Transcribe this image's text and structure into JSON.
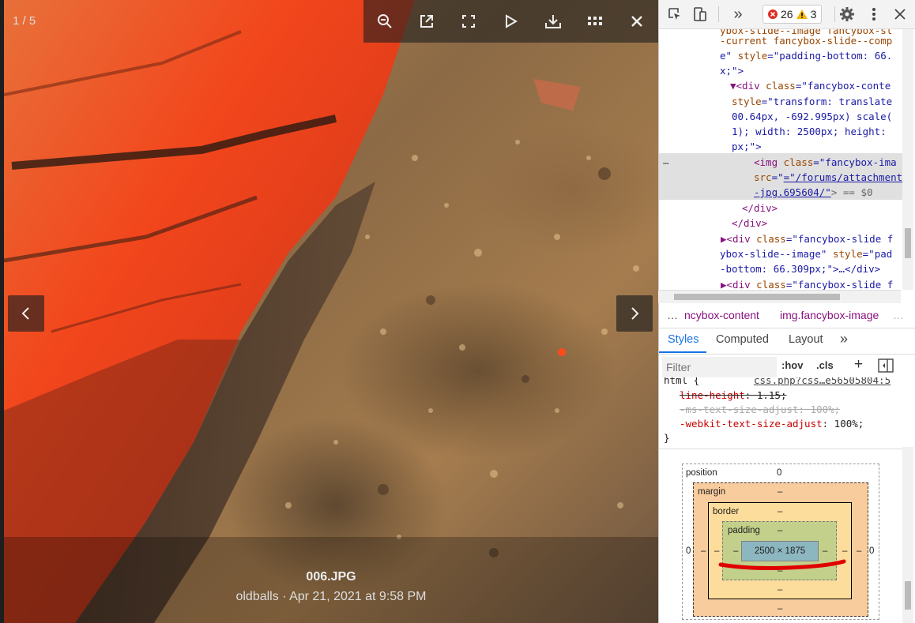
{
  "viewer": {
    "counter": "1 / 5",
    "toolbar_icons": [
      "zoom-out-icon",
      "external-link-icon",
      "fullscreen-icon",
      "play-icon",
      "download-icon",
      "thumbnails-icon",
      "close-icon"
    ],
    "caption_title": "006.JPG",
    "caption_meta": "oldballs · Apr 21, 2021 at 9:58 PM"
  },
  "devtools": {
    "error_count": "26",
    "warning_count": "3",
    "elements_lines": [
      {
        "l1": "e\" ",
        "a": "style",
        "v": "\"padding-bottom: 66."
      },
      {
        "t": "x;\">"
      }
    ],
    "code": {
      "line0": "ybox-slide--image fancybox-sl",
      "line1a": "-current fancybox-slide--comp",
      "line2a": "e\"",
      "line2b": "style",
      "line2c": "=\"padding-bottom: 66.",
      "line3": "x;\">",
      "line4tag": "▼<div",
      "line4attr": "class",
      "line4val": "=\"fancybox-conte",
      "line5attr": "style",
      "line5val": "=\"transform: translate",
      "line6": "00.64px, -692.995px) scale(",
      "line7": "1); width: 2500px; height:",
      "line8": "px;\">",
      "line9tag": "<img",
      "line9attr": "class",
      "line9val": "=\"fancybox-ima",
      "line10attr": "src",
      "line10val": "=\"/forums/attachments",
      "line11val": "-jpg.695604/\"",
      "line11end": "> == $0",
      "line12": "</div>",
      "line13": "</div>",
      "line14tag": "▶<div",
      "line14attr": "class",
      "line14val": "=\"fancybox-slide f",
      "line15a": "ybox-slide--image\"",
      "line15b": "style",
      "line15c": "=\"pad",
      "line16": "-bottom: 66.309px;\">…</div>",
      "line17tag": "▶<div",
      "line17attr": "class",
      "line17val": "=\"fancybox-slide f"
    },
    "ellipsis": "…",
    "crumb_1": "ncybox-content",
    "crumb_2": "img.fancybox-image",
    "crumb_more": "…",
    "tabs": {
      "styles": "Styles",
      "computed": "Computed",
      "layout": "Layout",
      "more": "»"
    },
    "filter_placeholder": "Filter",
    "hov": ":hov",
    "cls": ".cls",
    "plus": "+",
    "styles_rule": {
      "selector": "html {",
      "source": "css.php?css…e56505804:5",
      "decl1_prop": "line-height",
      "decl1_val": ": 1.15;",
      "decl2": "-ms-text-size-adjust: 100%;",
      "decl3_prop": "-webkit-text-size-adjust",
      "decl3_val": ": 100%;",
      "close": "}"
    },
    "boxmodel": {
      "position_label": "position",
      "position_val": "0",
      "margin_label": "margin",
      "margin_val": "–",
      "border_label": "border",
      "border_val": "–",
      "padding_label": "padding",
      "padding_val": "–",
      "content": "2500 × 1875",
      "left_outer": "0",
      "right_outer": "0",
      "dash": "–"
    }
  }
}
